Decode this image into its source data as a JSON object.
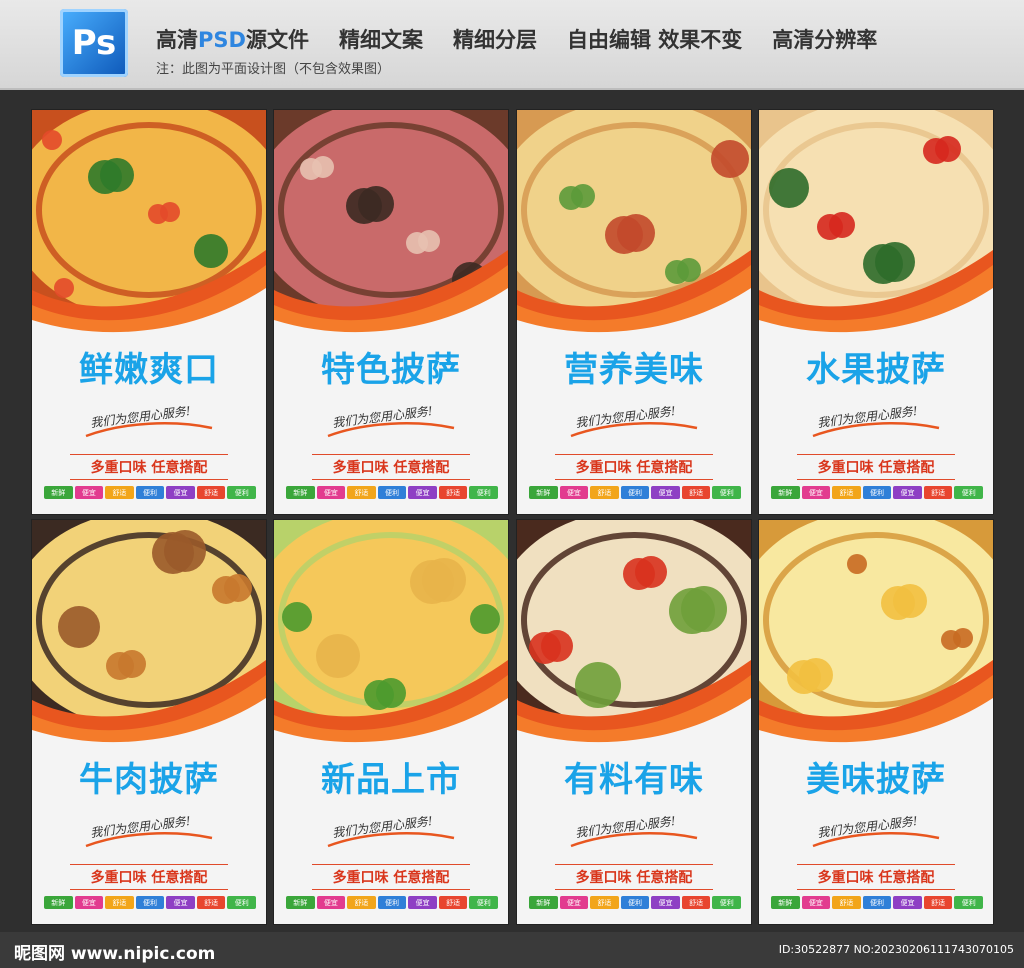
{
  "header": {
    "logo_text": "Ps",
    "features": [
      {
        "pre": "高清",
        "hl": "PSD",
        "post": "源文件"
      },
      {
        "pre": "精细文案",
        "hl": "",
        "post": ""
      },
      {
        "pre": "精细分层",
        "hl": "",
        "post": ""
      },
      {
        "pre": "自由编辑 效果不变",
        "hl": "",
        "post": ""
      },
      {
        "pre": "高清分辨率",
        "hl": "",
        "post": ""
      }
    ],
    "note": "注：此图为平面设计图（不包含效果图）"
  },
  "posters": [
    {
      "title": "鲜嫩爽口",
      "slogan": "我们为您用心服务!",
      "tagline": "多重口味 任意搭配",
      "photo": "pizza-tomato-basil"
    },
    {
      "title": "特色披萨",
      "slogan": "我们为您用心服务!",
      "tagline": "多重口味 任意搭配",
      "photo": "pizza-ham-slices"
    },
    {
      "title": "营养美味",
      "slogan": "我们为您用心服务!",
      "tagline": "多重口味 任意搭配",
      "photo": "pizza-vegetable"
    },
    {
      "title": "水果披萨",
      "slogan": "我们为您用心服务!",
      "tagline": "多重口味 任意搭配",
      "photo": "pizza-cherry-tomato"
    },
    {
      "title": "牛肉披萨",
      "slogan": "我们为您用心服务!",
      "tagline": "多重口味 任意搭配",
      "photo": "pizza-cheese-pull-board"
    },
    {
      "title": "新品上市",
      "slogan": "我们为您用心服务!",
      "tagline": "多重口味 任意搭配",
      "photo": "pizza-broccoli-closeup"
    },
    {
      "title": "有料有味",
      "slogan": "我们为您用心服务!",
      "tagline": "多重口味 任意搭配",
      "photo": "pizza-slice-pepper"
    },
    {
      "title": "美味披萨",
      "slogan": "我们为您用心服务!",
      "tagline": "多重口味 任意搭配",
      "photo": "pizza-cheese-stretch"
    }
  ],
  "badges": [
    {
      "label": "新鲜",
      "color": "#3aa63a"
    },
    {
      "label": "便宜",
      "color": "#e23b8f"
    },
    {
      "label": "舒适",
      "color": "#f2a51a"
    },
    {
      "label": "便利",
      "color": "#2f7fd8"
    },
    {
      "label": "便宜",
      "color": "#8e3fc4"
    },
    {
      "label": "舒适",
      "color": "#e8452f"
    },
    {
      "label": "便利",
      "color": "#40b549"
    }
  ],
  "footer": {
    "site": "昵图网 www.nipic.com",
    "id": "ID:30522877 NO:20230206111743070105"
  },
  "colors": {
    "title": "#1aa3e8",
    "wave": "#e8561f",
    "tagline": "#d9361c"
  }
}
